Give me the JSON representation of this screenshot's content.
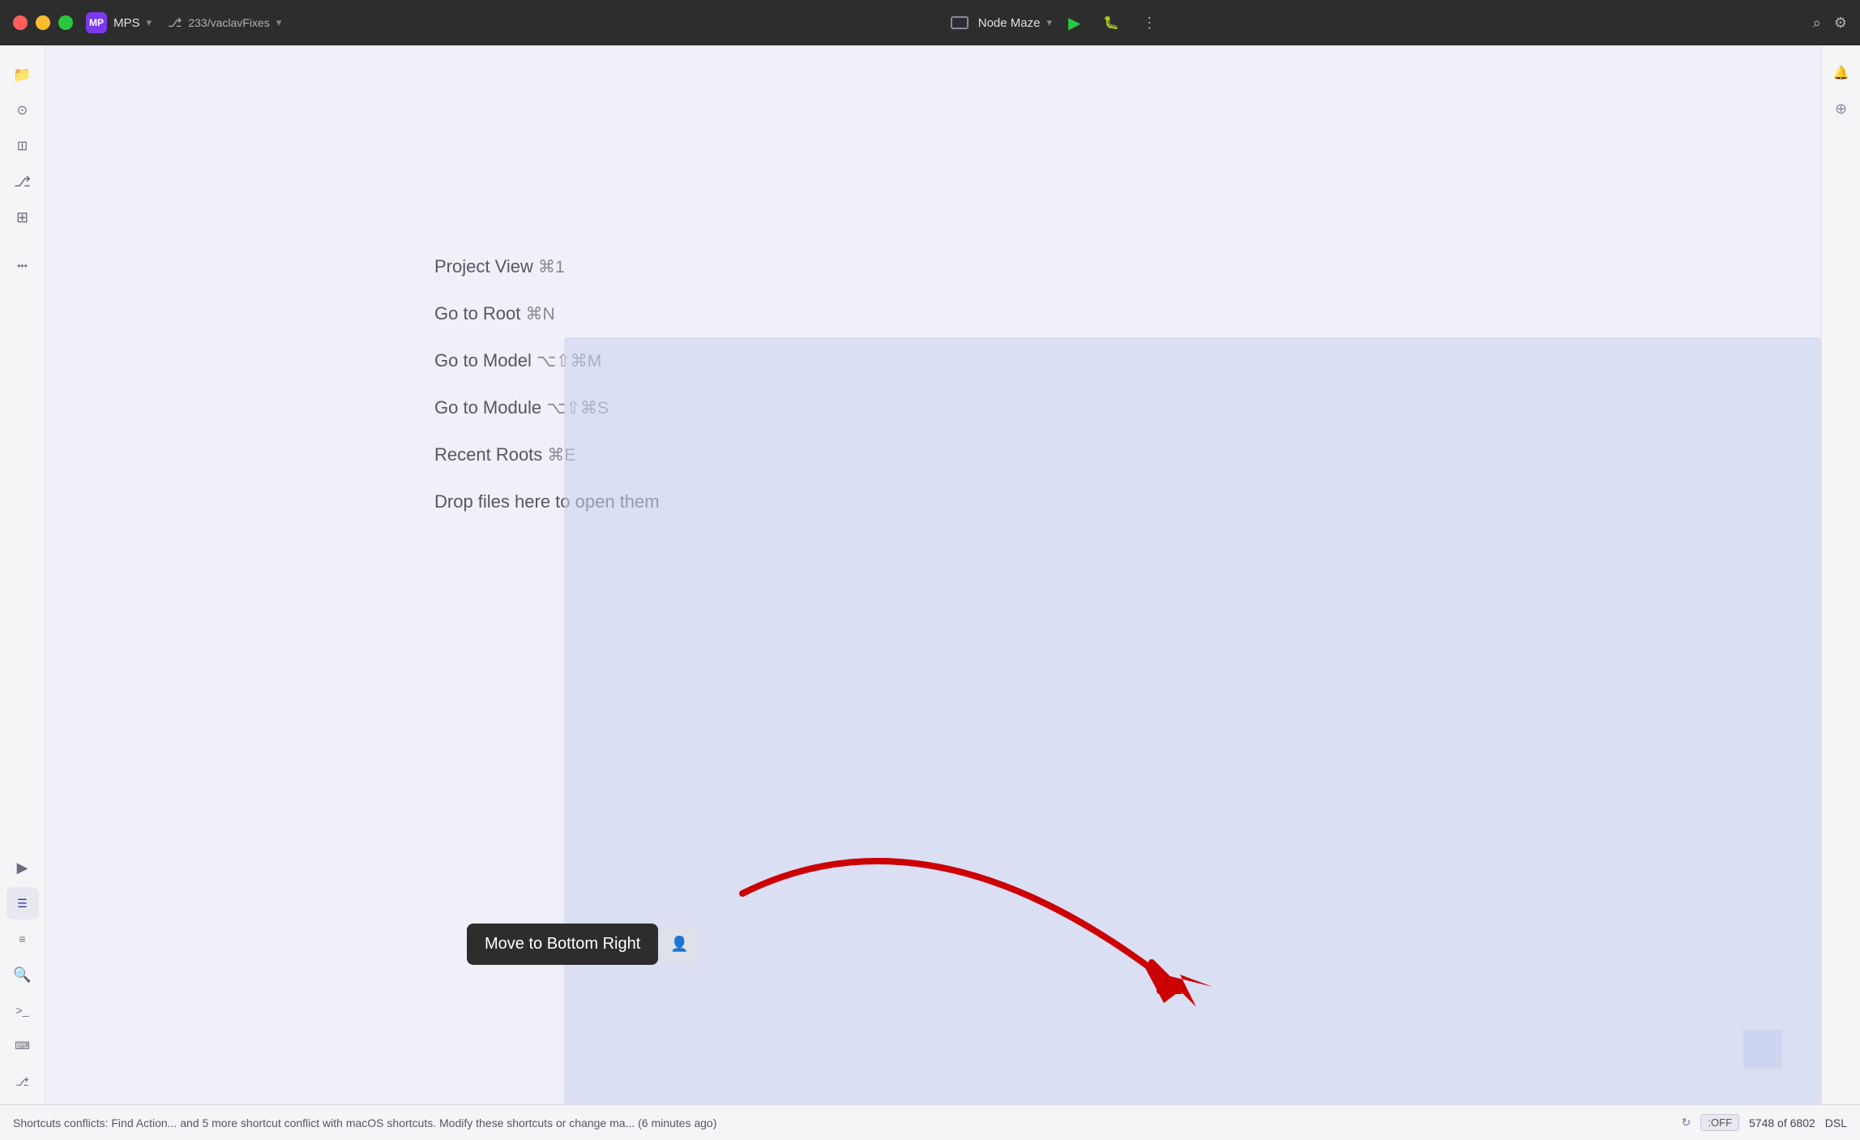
{
  "titlebar": {
    "traffic_lights": [
      "red",
      "yellow",
      "green"
    ],
    "app_label": "MPS",
    "app_initials": "MP",
    "branch_icon": "⎇",
    "branch_label": "233/vaclavFixes",
    "branch_chevron": "▾",
    "node_maze_label": "Node Maze",
    "node_maze_chevron": "▾",
    "run_icon": "▶",
    "debug_icon": "🐛",
    "more_icon": "⋮",
    "search_icon": "⌕",
    "settings_icon": "⚙"
  },
  "sidebar": {
    "items": [
      {
        "label": "📁",
        "name": "folder-icon"
      },
      {
        "label": "⊙",
        "name": "commit-icon"
      },
      {
        "label": "≡",
        "name": "filter-icon"
      },
      {
        "label": "⎇",
        "name": "branch-icon"
      },
      {
        "label": "⊞",
        "name": "layout-icon"
      }
    ],
    "more_label": "•••",
    "bottom_items": [
      {
        "label": "▶",
        "name": "run-icon"
      },
      {
        "label": "≡",
        "name": "list-icon",
        "active": true
      },
      {
        "label": "☰",
        "name": "menu-icon"
      },
      {
        "label": "🔍",
        "name": "search-icon"
      },
      {
        "label": ">_",
        "name": "terminal-icon"
      },
      {
        "label": "⌨",
        "name": "keyboard-icon"
      },
      {
        "label": "⎇",
        "name": "git-icon"
      }
    ]
  },
  "right_sidebar": {
    "items": [
      {
        "label": "🔔",
        "name": "notification-icon"
      },
      {
        "label": "⊕",
        "name": "plus-icon"
      }
    ]
  },
  "editor": {
    "menu_items": [
      {
        "text": "Project View",
        "shortcut": "⌘1"
      },
      {
        "text": "Go to Root",
        "shortcut": "⌘N"
      },
      {
        "text": "Go to Model",
        "shortcut": "⌥⇧⌘M"
      },
      {
        "text": "Go to Module",
        "shortcut": "⌥⇧⌘S"
      },
      {
        "text": "Recent Roots",
        "shortcut": "⌘E"
      },
      {
        "text": "Drop files here to open them",
        "shortcut": ""
      }
    ]
  },
  "tooltip": {
    "label": "Move to Bottom Right",
    "icon": "👤"
  },
  "status_bar": {
    "text": "Shortcuts conflicts: Find Action... and 5 more shortcut conflict with macOS shortcuts. Modify these shortcuts or change ma... (6 minutes ago)",
    "sync_icon": "↻",
    "off_badge": ":OFF",
    "counter": "5748 of 6802",
    "dsl_label": "DSL"
  }
}
